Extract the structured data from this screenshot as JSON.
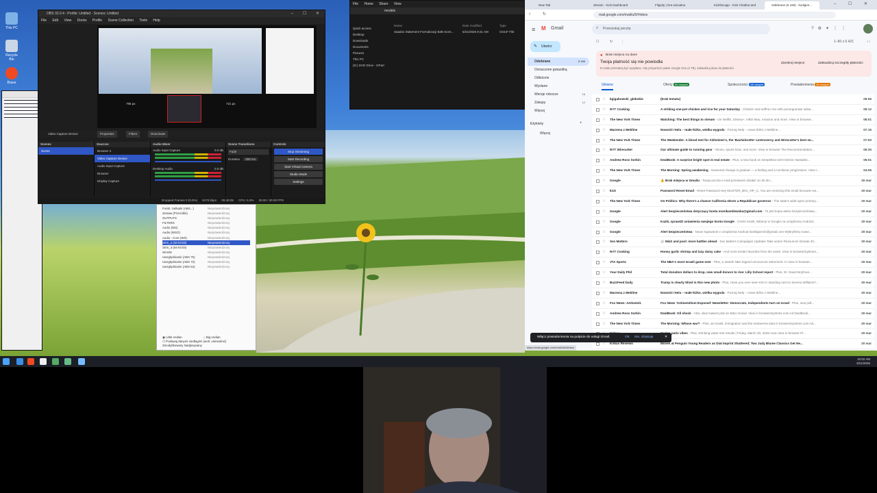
{
  "desktop": {
    "icons": [
      {
        "label": "This PC",
        "icon": "pc-icon",
        "color": "#7fb2e6"
      },
      {
        "label": "Recycle Bin",
        "icon": "recycle-bin-icon",
        "color": "#c9d6e6"
      },
      {
        "label": "Brave",
        "icon": "brave-icon",
        "color": "#f04a23"
      }
    ]
  },
  "obs": {
    "title": "OBS 32.0.4 - Profile: Untitled - Scenes: Untitled",
    "menu": [
      "File",
      "Edit",
      "View",
      "Docks",
      "Profile",
      "Scene Collection",
      "Tools",
      "Help"
    ],
    "preview": {
      "left_label": "795 px",
      "right_label": "721 px"
    },
    "source_toolbar": {
      "selected": "Video Capture Device",
      "properties": "Properties",
      "filters": "Filters",
      "deactivate": "Deactivate"
    },
    "docks": {
      "scenes": {
        "title": "Scenes",
        "items": [
          "Scene"
        ]
      },
      "sources": {
        "title": "Sources",
        "items": [
          "Browser 2",
          "Video Capture Device",
          "Audio Input Capture",
          "Browser",
          "Display Capture"
        ]
      },
      "mixer": {
        "title": "Audio Mixer",
        "channels": [
          {
            "name": "Audio Input Capture",
            "level": "0.0 dB"
          },
          {
            "name": "Desktop Audio",
            "level": "0.0 dB"
          }
        ]
      },
      "transitions": {
        "title": "Scene Transitions",
        "type": "Fade",
        "duration_label": "Duration",
        "duration": "300 ms"
      },
      "controls": {
        "title": "Controls",
        "buttons": [
          "Stop Streaming",
          "Start Recording",
          "Start Virtual Camera",
          "Studio Mode",
          "Settings"
        ]
      }
    },
    "status": {
      "dropped": "Dropped Frames 0 (0.0%)",
      "bitrate": "8170 kbps",
      "time": "05:48:08",
      "cpu": "CPU: 6.3%",
      "fps": "30.00 / 30.00 FPS"
    }
  },
  "explorer": {
    "tabs": [
      "File",
      "Home",
      "Share",
      "View"
    ],
    "path": "models",
    "columns": [
      "Name",
      "Date modified",
      "Type"
    ],
    "files": [
      {
        "name": "Saados Statement Formalizacji B2B Scen...",
        "date": "5/21/2026 8:31 AM",
        "type": "GGUF File"
      }
    ],
    "nav": [
      "Quick access",
      "Desktop",
      "Downloads",
      "Documents",
      "Pictures",
      "This PC",
      "(D:) DVD Drive - GPart"
    ]
  },
  "settings_panel": {
    "items": [
      "Funkt. zaślepki (ABS...)",
      "Zestaw (Przeróbki)",
      "OUTPUTS",
      "FILTERS",
      "Audio (WS)",
      "Audio (WSO)",
      "Audio - Core (WS)",
      "Strm_2 (32-bit bit)",
      "Strm_3 (64-bit bit)",
      "WASM",
      "Uwzględnianie (ABS 76)",
      "Uwzględnianie (ABS 72)",
      "Uwzględnianie (ABS 64)"
    ],
    "status_col": "Niepotwierdzony",
    "selected_index": 7,
    "footer": {
      "radio1": "Little endian",
      "radio2": "Big endian",
      "checkbox": "Podawaj danymi niedługimi (wolt. uniewolnić)",
      "note": "Zmodyfikowany Nadpisywany"
    }
  },
  "gmail": {
    "browser_tabs": [
      "New Tab",
      "Stream - Kick Dashboard",
      "Flippity | Gra wizualna",
      "Kicklist.app - Kick Chatbot and Clo...",
      "Odebrane (5 159) - kodigen..."
    ],
    "url": "mail.google.com/mail/u/0/#inbox",
    "search_placeholder": "Przeszukaj pocztę",
    "compose": "Utwórz",
    "nav": [
      {
        "label": "Odebrane",
        "count": "5 159",
        "active": true
      },
      {
        "label": "Oznaczone gwiazdką",
        "count": "",
        "active": false
      },
      {
        "label": "Odłożone",
        "count": "",
        "active": false
      },
      {
        "label": "Wysłane",
        "count": "",
        "active": false
      },
      {
        "label": "Wersje robocze",
        "count": "16",
        "active": false
      },
      {
        "label": "Zakupy",
        "count": "12",
        "active": false
      },
      {
        "label": "Więcej",
        "count": "",
        "active": false
      }
    ],
    "labels_title": "Etykiety",
    "labels_more": "Więcej",
    "pager": "1–50 z 6 421",
    "alert": {
      "title": "Brak miejsca na dane",
      "headline": "Twoja płatność się nie powiodła",
      "body": "E-maile przestaną być wysyłane. Aby przywrócić pakiet Google One (2 TB), zaktualizuj dane do płatności.",
      "dismiss": "Zamknij miejsce",
      "action": "Zaktualizuj szczegóły płatności"
    },
    "categories": [
      {
        "label": "Główne",
        "badge": ""
      },
      {
        "label": "Oferty",
        "badge": "50 nowych"
      },
      {
        "label": "Społeczności",
        "badge": "15 nowych"
      },
      {
        "label": "Powiadomienia",
        "badge": "50 nowych"
      }
    ],
    "messages": [
      {
        "sender": "kgigabowski_glebokie",
        "subject": "(brak tematu)",
        "snippet": "",
        "date": "09:55"
      },
      {
        "sender": "NYT Cooking",
        "subject": "A striking one-pot chicken and rice for your Saturday",
        "snippet": " - Chicken and saffron rice with pomegranate salsa...",
        "date": "09:12"
      },
      {
        "sender": "The New York Times",
        "subject": "Watching: The best things to stream",
        "snippet": " - On Netflix, Disney+, HBO Max, Amazon and more. View in browser...",
        "date": "08:01"
      },
      {
        "sender": "Marzena z Mebline",
        "subject": "Nowość! Nela – małe łóżko, wielka wygoda",
        "snippet": " - Poznaj Nelę – nowe łóżko z Mebline...",
        "date": "07:15"
      },
      {
        "sender": "The New York Times",
        "subject": "The Weekender: A blood test for Alzheimer's, the 'Bachelorette' controversy and Wirecutter's best ne...",
        "snippet": "",
        "date": "07:00"
      },
      {
        "sender": "NYT Wirecutter",
        "subject": "Our ultimate guide to running gear",
        "snippet": " - Shoes, sports bras, and more. View in browser The Recommendation...",
        "date": "06:30"
      },
      {
        "sender": "Andrew Ross Sorkin",
        "subject": "DealBook: A surprise bright spot in real estate",
        "snippet": " - Plus, a new book on DeepMind CEO Demis Hassabis...",
        "date": "06:01"
      },
      {
        "sender": "The New York Times",
        "subject": "The Morning: Spring awakening",
        "snippet": " - Seasonal change is gradual — a feeling and a nonlinear progression. View i...",
        "date": "04:06"
      },
      {
        "sender": "Google",
        "subject": "⚠️ Brak miejsca w Gmailu",
        "snippet": " - Twoja poczta e-mail przestanie działać za 30 dni...",
        "date": "20 mar"
      },
      {
        "sender": "kick",
        "subject": "Password Reset Email",
        "snippet": " - Reset Password Hey MUSTER_BIG_VIP_C, You are receiving this email because we...",
        "date": "20 mar"
      },
      {
        "sender": "The New York Times",
        "subject": "On Politics: Why there's a chance California elects a Republican governor",
        "snippet": " - The state's wide-open primary...",
        "date": "20 mar"
      },
      {
        "sender": "Google",
        "subject": "Alert bezpieczeństwa dotyczący konta monikamilewska@gmail.com",
        "snippet": " - To jest kopia alertu bezpieczeństwa...",
        "date": "20 mar"
      },
      {
        "sender": "Google",
        "subject": "Kazik, sprawdź ustawienia swojego konta Google",
        "snippet": " - Cześć Kazik, Witamy w Google na urządzeniu Android...",
        "date": "20 mar"
      },
      {
        "sender": "Google",
        "subject": "Alert bezpieczeństwa",
        "snippet": " - Nowe logowanie z urządzenia Android kamilgarmin@gmail.com Wykryliśmy nowe...",
        "date": "20 mar"
      },
      {
        "sender": "Sex Matters",
        "subject": "📰 M&S and pool: more battles ahead",
        "snippet": " - Sex Matters Campaigns Updates Take action Resources Donate 20...",
        "date": "20 mar"
      },
      {
        "sender": "NYT Cooking",
        "subject": "Honey garlic shrimp and lazy daisy cake",
        "snippet": " - And more tender favorites from the week. View in browser|nytimes...",
        "date": "20 mar"
      },
      {
        "sender": "JTA Sports",
        "subject": "The NBA's most Israeli game ever",
        "snippet": " - Plus, a Jewish NBA legend announces retirement. In view in browser...",
        "date": "20 mar"
      },
      {
        "sender": "Your Daily Phil",
        "subject": "Total donation dollars to drop, new small donors to rise: Lilly School report",
        "snippet": " - Plus, Dr. David Bryfman...",
        "date": "20 mar"
      },
      {
        "sender": "BuzzFeed Daily",
        "subject": "Trump is clearly blind in this new photo",
        "snippet": " - Plus, Have you ever seen Kim K standing next to Serena Williams?...",
        "date": "20 mar"
      },
      {
        "sender": "Marzena z Mebline",
        "subject": "Nowość! Nela – małe łóżko, wielka wygoda",
        "snippet": " - Poznaj Nelę – nowe łóżko z Mebline...",
        "date": "20 mar"
      },
      {
        "sender": "Fox News: Antisemit.",
        "subject": "Fox News 'Antisemitism Exposed' Newsletter: Democrats, Independents turn on Israel",
        "snippet": " - Plus, new poll...",
        "date": "20 mar"
      },
      {
        "sender": "Andrew Ross Sorkin",
        "subject": "DealBook: Oil shock",
        "snippet": " - Also, deal makers plot an M&A revival. View in browser|nytimes.com Ad DealBook...",
        "date": "20 mar"
      },
      {
        "sender": "The New York Times",
        "subject": "The Morning: Whose war?",
        "snippet": " - Plus, as Israeli, immigration and the metaverse idea in browser|nytimes.com Ad...",
        "date": "20 mar"
      },
      {
        "sender": "Kirkus",
        "subject": "Spring patio vibes",
        "snippet": " - Plus, Drinking water test results | Friday, March 20, 2026 Aura Vera in browser Pl...",
        "date": "20 mar"
      },
      {
        "sender": "Kirkus Reviews",
        "subject": "Moves at Penguin Young Readers as Dial Imprint Shattered; Two Judy Blume Classics Get Ne...",
        "snippet": "",
        "date": "20 mar"
      }
    ],
    "toast": {
      "text": "Włącz powiadomienia na pulpicie do usługi Gmail.",
      "ok": "OK",
      "no": "Nie, dziękuję"
    },
    "status_url": "https://mail.google.com/mail/u/0/#inbox"
  },
  "taskbar": {
    "time": "10:02 AM",
    "date": "3/21/2026"
  }
}
